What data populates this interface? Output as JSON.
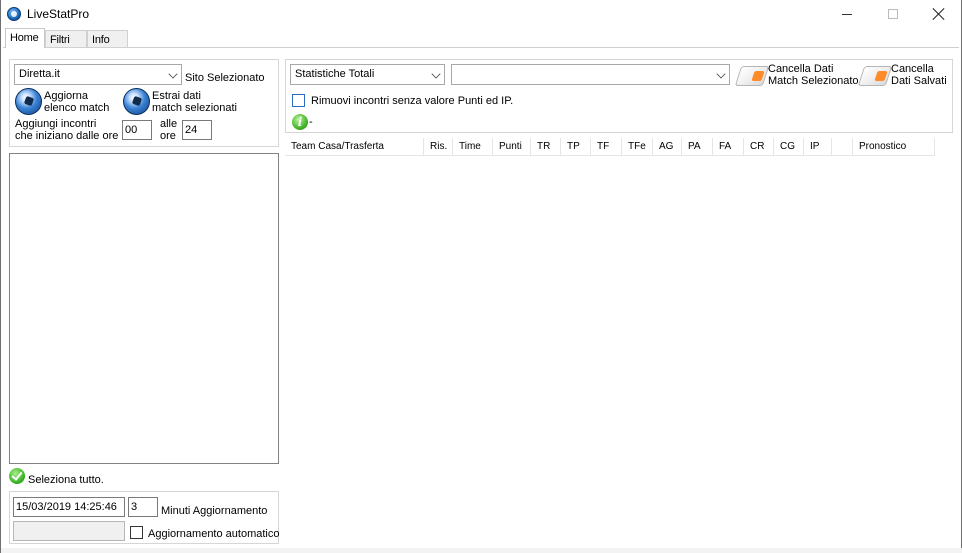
{
  "window": {
    "title": "LiveStatPro"
  },
  "tabs": [
    {
      "label": "Home",
      "active": true
    },
    {
      "label": "Filtri",
      "active": false
    },
    {
      "label": "Info",
      "active": false
    }
  ],
  "left_panel": {
    "site_combo_value": "Diretta.it",
    "site_label": "Sito Selezionato",
    "refresh_button": {
      "line1": "Aggiorna",
      "line2": "elenco match"
    },
    "extract_button": {
      "line1": "Estrai dati",
      "line2": "match selezionati"
    },
    "add_matches_label": {
      "line1": "Aggiungi incontri",
      "line2": "che iniziano dalle ore"
    },
    "from_hour": "00",
    "to_label": {
      "line1": "alle",
      "line2": "ore"
    },
    "to_hour": "24",
    "select_all_label": "Seleziona tutto.",
    "datetime_value": "15/03/2019 14:25:46",
    "minutes_value": "3",
    "minutes_label": "Minuti Aggiornamento",
    "auto_update_label": "Aggiornamento automatico"
  },
  "right_panel": {
    "stats_combo_value": "Statistiche Totali",
    "second_combo_value": "",
    "clear_selected_button": {
      "line1": "Cancella Dati",
      "line2": "Match Selezionato"
    },
    "clear_saved_button": {
      "line1": "Cancella",
      "line2": "Dati Salvati"
    },
    "remove_matches_label": "Rimuovi incontri senza valore Punti ed IP.",
    "info_suffix": "-"
  },
  "grid": {
    "columns": [
      "Team Casa/Trasferta",
      "Ris.",
      "Time",
      "Punti",
      "TR",
      "TP",
      "TF",
      "TFe",
      "AG",
      "PA",
      "FA",
      "CR",
      "CG",
      "IP",
      "",
      "Pronostico"
    ]
  },
  "colors": {
    "accent": "#2b6cc4",
    "border": "#d6d6d6"
  }
}
